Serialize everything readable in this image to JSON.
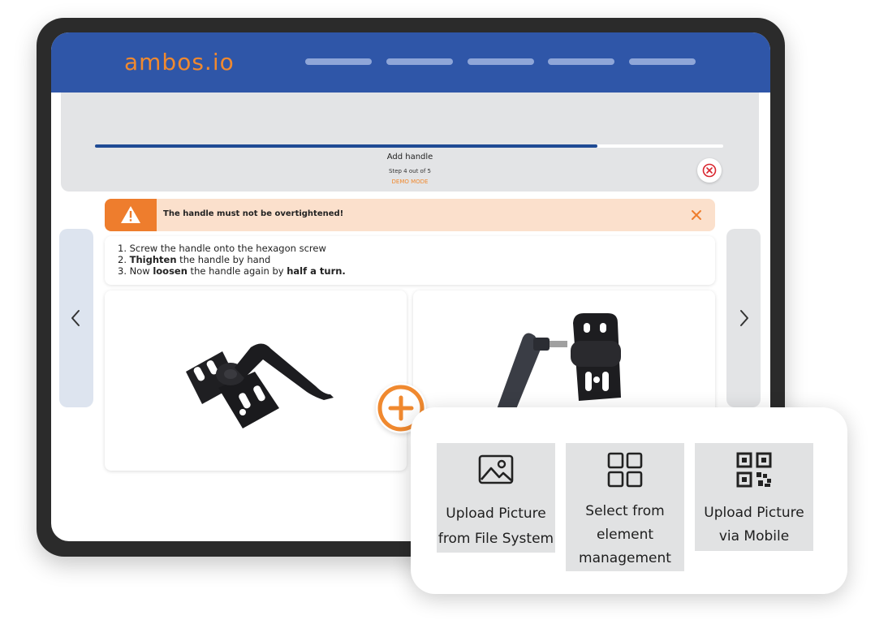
{
  "app": {
    "logo_text": "ambos.io",
    "nav_items_count_visible": 5
  },
  "step": {
    "title": "Add handle",
    "counter": "Step 4 out of 5",
    "mode": "DEMO MODE",
    "progress_percent": 80
  },
  "warning": {
    "text": "The handle must not be overtightened!",
    "icon": "warning-triangle-icon",
    "close_icon": "x-icon"
  },
  "instructions": {
    "line1": "1. Screw the handle onto the hexagon screw",
    "line2_num": "2.",
    "line2_bold": "Thighten",
    "line2_rest": " the handle by hand",
    "line3_pre": "3. Now ",
    "line3_bold1": "loosen",
    "line3_mid": " the handle again by ",
    "line3_bold2": "half a turn."
  },
  "images": [
    {
      "subject": "hinge-with-handle-photo"
    },
    {
      "subject": "hinge-and-handle-separated-photo"
    }
  ],
  "add_menu": {
    "options": [
      {
        "icon": "image-icon",
        "line1": "Upload Picture",
        "line2": "from File System"
      },
      {
        "icon": "grid-icon",
        "line1": "Select from",
        "line2": "element",
        "line3": "management"
      },
      {
        "icon": "qr-code-icon",
        "line1": "Upload Picture",
        "line2": "via Mobile"
      }
    ]
  },
  "colors": {
    "brand_blue": "#2f56a8",
    "accent_orange": "#f0892f",
    "warning_bg": "#fbe0cc",
    "progress": "#1f4a94"
  }
}
